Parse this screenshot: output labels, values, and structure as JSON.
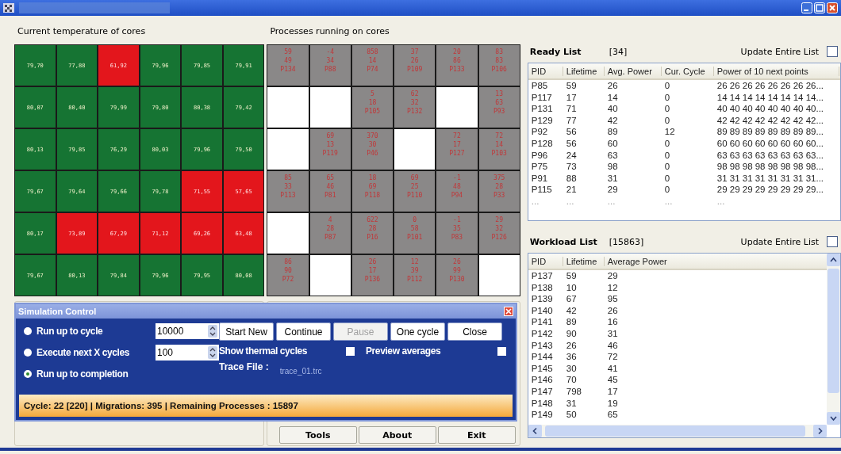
{
  "temperature_panel": {
    "title": "Current temperature of cores",
    "cells": [
      {
        "value": "79,70",
        "hot": false
      },
      {
        "value": "77,88",
        "hot": false
      },
      {
        "value": "61,92",
        "hot": true
      },
      {
        "value": "79,96",
        "hot": false
      },
      {
        "value": "79,85",
        "hot": false
      },
      {
        "value": "79,91",
        "hot": false
      },
      {
        "value": "80,07",
        "hot": false
      },
      {
        "value": "80,40",
        "hot": false
      },
      {
        "value": "79,99",
        "hot": false
      },
      {
        "value": "79,80",
        "hot": false
      },
      {
        "value": "80,38",
        "hot": false
      },
      {
        "value": "79,42",
        "hot": false
      },
      {
        "value": "80,13",
        "hot": false
      },
      {
        "value": "79,85",
        "hot": false
      },
      {
        "value": "76,29",
        "hot": false
      },
      {
        "value": "80,03",
        "hot": false
      },
      {
        "value": "79,96",
        "hot": false
      },
      {
        "value": "79,50",
        "hot": false
      },
      {
        "value": "79,67",
        "hot": false
      },
      {
        "value": "79,64",
        "hot": false
      },
      {
        "value": "79,66",
        "hot": false
      },
      {
        "value": "79,78",
        "hot": false
      },
      {
        "value": "71,55",
        "hot": true
      },
      {
        "value": "57,65",
        "hot": true
      },
      {
        "value": "80,17",
        "hot": false
      },
      {
        "value": "73,89",
        "hot": true
      },
      {
        "value": "67,29",
        "hot": true
      },
      {
        "value": "71,12",
        "hot": true
      },
      {
        "value": "69,26",
        "hot": true
      },
      {
        "value": "63,48",
        "hot": true
      },
      {
        "value": "79,67",
        "hot": false
      },
      {
        "value": "80,13",
        "hot": false
      },
      {
        "value": "79,84",
        "hot": false
      },
      {
        "value": "79,96",
        "hot": false
      },
      {
        "value": "79,95",
        "hot": false
      },
      {
        "value": "80,08",
        "hot": false
      }
    ]
  },
  "process_panel": {
    "title": "Processes running on cores",
    "cells": [
      {
        "occupied": true,
        "lines": [
          "59",
          "49",
          "P134"
        ]
      },
      {
        "occupied": true,
        "lines": [
          "-4",
          "34",
          "P88"
        ]
      },
      {
        "occupied": true,
        "lines": [
          "858",
          "14",
          "P74"
        ]
      },
      {
        "occupied": true,
        "lines": [
          "37",
          "26",
          "P109"
        ]
      },
      {
        "occupied": true,
        "lines": [
          "20",
          "86",
          "P133"
        ]
      },
      {
        "occupied": true,
        "lines": [
          "83",
          "83",
          "P106"
        ]
      },
      {
        "occupied": false
      },
      {
        "occupied": false
      },
      {
        "occupied": true,
        "lines": [
          "5",
          "18",
          "P105"
        ]
      },
      {
        "occupied": true,
        "lines": [
          "62",
          "32",
          "P132"
        ]
      },
      {
        "occupied": false
      },
      {
        "occupied": true,
        "lines": [
          "13",
          "63",
          "P93"
        ]
      },
      {
        "occupied": false
      },
      {
        "occupied": true,
        "lines": [
          "69",
          "13",
          "P119"
        ]
      },
      {
        "occupied": true,
        "lines": [
          "370",
          "30",
          "P46"
        ]
      },
      {
        "occupied": false
      },
      {
        "occupied": true,
        "lines": [
          "72",
          "17",
          "P127"
        ]
      },
      {
        "occupied": true,
        "lines": [
          "72",
          "14",
          "P103"
        ]
      },
      {
        "occupied": true,
        "lines": [
          "85",
          "33",
          "P113"
        ]
      },
      {
        "occupied": true,
        "lines": [
          "65",
          "46",
          "P81"
        ]
      },
      {
        "occupied": true,
        "lines": [
          "18",
          "69",
          "P118"
        ]
      },
      {
        "occupied": true,
        "lines": [
          "69",
          "25",
          "P110"
        ]
      },
      {
        "occupied": true,
        "lines": [
          "-1",
          "48",
          "P94"
        ]
      },
      {
        "occupied": true,
        "lines": [
          "375",
          "28",
          "P33"
        ]
      },
      {
        "occupied": false
      },
      {
        "occupied": true,
        "lines": [
          "4",
          "28",
          "P87"
        ]
      },
      {
        "occupied": true,
        "lines": [
          "622",
          "28",
          "P16"
        ]
      },
      {
        "occupied": true,
        "lines": [
          "0",
          "58",
          "P101"
        ]
      },
      {
        "occupied": true,
        "lines": [
          "-1",
          "35",
          "P83"
        ]
      },
      {
        "occupied": true,
        "lines": [
          "29",
          "32",
          "P126"
        ]
      },
      {
        "occupied": true,
        "lines": [
          "86",
          "90",
          "P72"
        ]
      },
      {
        "occupied": false
      },
      {
        "occupied": true,
        "lines": [
          "26",
          "17",
          "P136"
        ]
      },
      {
        "occupied": true,
        "lines": [
          "12",
          "39",
          "P112"
        ]
      },
      {
        "occupied": true,
        "lines": [
          "26",
          "99",
          "P130"
        ]
      },
      {
        "occupied": false
      }
    ]
  },
  "bottom_buttons": [
    "Tools",
    "About",
    "Exit"
  ],
  "ready_list": {
    "title": "Ready List",
    "count": "[34]",
    "update_label": "Update Entire List",
    "update_checked": false,
    "columns": [
      "PID",
      "Lifetime",
      "Avg. Power",
      "Cur. Cycle",
      "Power of 10 next points"
    ],
    "rows": [
      [
        "P85",
        "59",
        "26",
        "0",
        "26 26 26 26 26 26 26 26..."
      ],
      [
        "P117",
        "17",
        "14",
        "0",
        "14 14 14 14 14 14 14 14..."
      ],
      [
        "P131",
        "71",
        "40",
        "0",
        "40 40 40 40 40 40 40 40..."
      ],
      [
        "P129",
        "77",
        "42",
        "0",
        "42 42 42 42 42 42 42 42..."
      ],
      [
        "P92",
        "56",
        "89",
        "12",
        "89 89 89 89 89 89 89 89..."
      ],
      [
        "P128",
        "56",
        "60",
        "0",
        "60 60 60 60 60 60 60 60..."
      ],
      [
        "P96",
        "24",
        "63",
        "0",
        "63 63 63 63 63 63 63 63..."
      ],
      [
        "P75",
        "73",
        "98",
        "0",
        "98 98 98 98 98 98 98 98..."
      ],
      [
        "P91",
        "88",
        "31",
        "0",
        "31 31 31 31 31 31 31 31..."
      ],
      [
        "P115",
        "21",
        "29",
        "0",
        "29 29 29 29 29 29 29 29..."
      ],
      [
        "...",
        "...",
        "...",
        "...",
        "..."
      ]
    ]
  },
  "workload_list": {
    "title": "Workload List",
    "count": "[15863]",
    "update_label": "Update Entire List",
    "update_checked": false,
    "columns": [
      "PID",
      "Lifetime",
      "Average Power"
    ],
    "rows": [
      [
        "P137",
        "59",
        "29"
      ],
      [
        "P138",
        "10",
        "12"
      ],
      [
        "P139",
        "67",
        "95"
      ],
      [
        "P140",
        "42",
        "26"
      ],
      [
        "P141",
        "89",
        "16"
      ],
      [
        "P142",
        "90",
        "31"
      ],
      [
        "P143",
        "26",
        "46"
      ],
      [
        "P144",
        "36",
        "72"
      ],
      [
        "P145",
        "30",
        "41"
      ],
      [
        "P146",
        "70",
        "45"
      ],
      [
        "P147",
        "798",
        "17"
      ],
      [
        "P148",
        "31",
        "19"
      ],
      [
        "P149",
        "50",
        "65"
      ]
    ]
  },
  "simulation_control": {
    "title": "Simulation Control",
    "modes": [
      {
        "label": "Run up to cycle",
        "selected": false,
        "value": "10000"
      },
      {
        "label": "Execute next X cycles",
        "selected": false,
        "value": "100"
      },
      {
        "label": "Run up to completion",
        "selected": true
      }
    ],
    "buttons": [
      {
        "label": "Start New",
        "disabled": false
      },
      {
        "label": "Continue",
        "disabled": false
      },
      {
        "label": "Pause",
        "disabled": true
      },
      {
        "label": "One cycle",
        "disabled": false
      },
      {
        "label": "Close",
        "disabled": false
      }
    ],
    "options": [
      {
        "label": "Show thermal cycles",
        "checked": false
      },
      {
        "label": "Preview averages",
        "checked": false
      }
    ],
    "trace_label": "Trace File :",
    "trace_file": "trace_01.trc",
    "status": "Cycle: 22 [220] | Migrations: 395 | Remaining Processes : 15897"
  }
}
